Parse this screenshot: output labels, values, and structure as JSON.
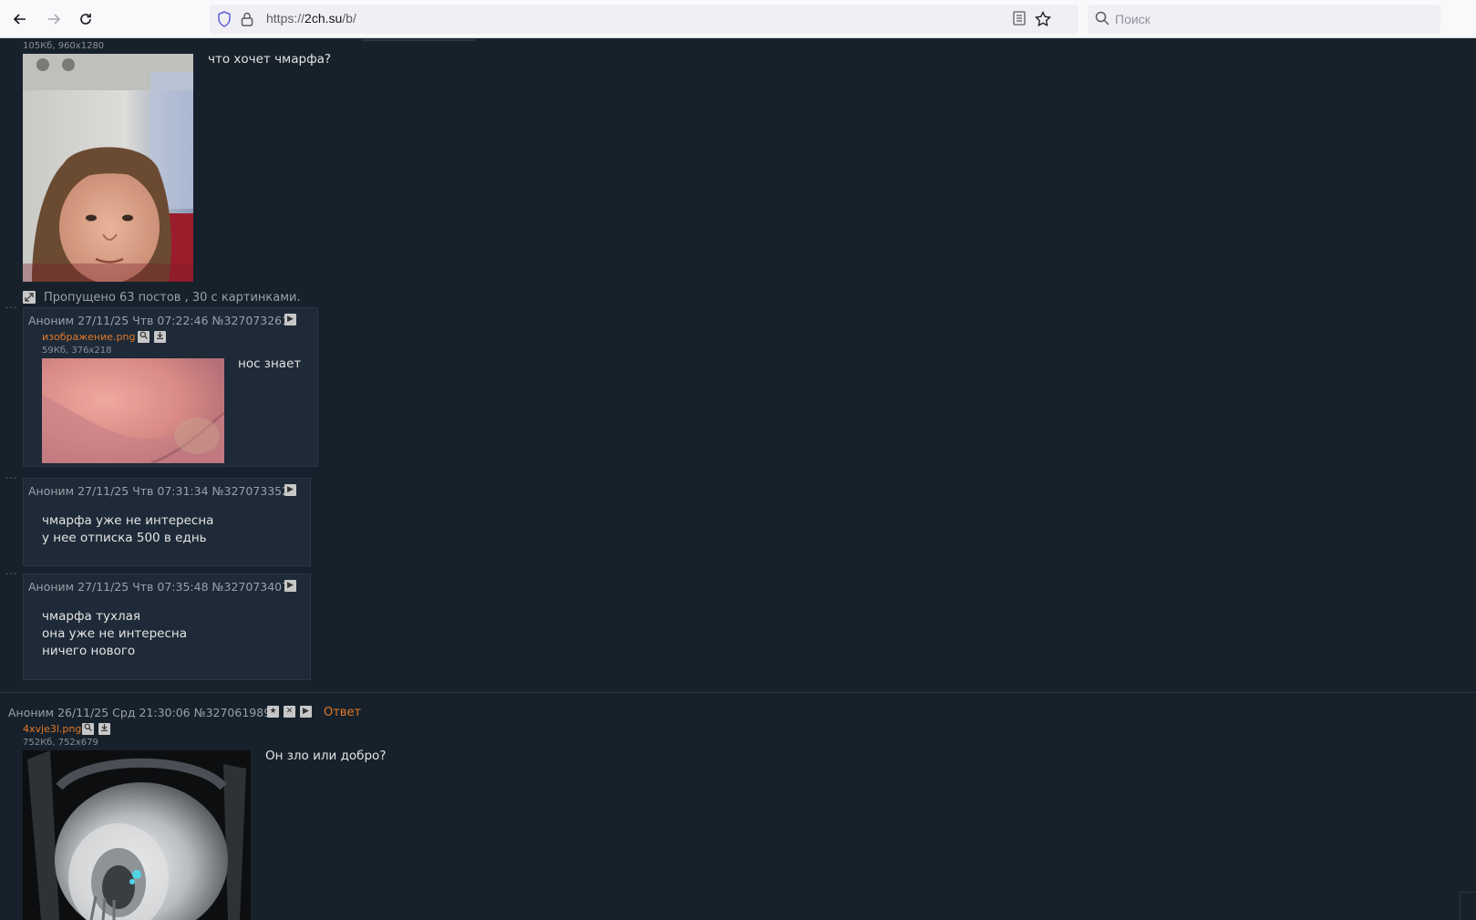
{
  "browser": {
    "url_prefix": "https://",
    "url_host": "2ch.su",
    "url_path": "/b/",
    "search_placeholder": "Поиск"
  },
  "op_thread1": {
    "file_info": "105Кб, 960x1280",
    "text": "что хочет чмарфа?",
    "omitted": "Пропущено 63 постов , 30 с картинками."
  },
  "replies": [
    {
      "meta": "Аноним 27/11/25 Чтв 07:22:46 №327073261",
      "file_name": "изображение.png",
      "file_info": "59Кб, 376x218",
      "text": "нос знает"
    },
    {
      "meta": "Аноним 27/11/25 Чтв 07:31:34 №327073352",
      "line1": "чмарфа уже не интересна",
      "line2": "у нее отписка 500 в еднь"
    },
    {
      "meta": "Аноним 27/11/25 Чтв 07:35:48 №327073407",
      "line1": "чмарфа тухлая",
      "line2": "она уже не интересна",
      "line3": "ничего нового"
    }
  ],
  "op_thread2": {
    "meta": "Аноним 26/11/25 Срд 21:30:06 №327061989",
    "reply_label": "Ответ",
    "file_name": "4xvje3l.png",
    "file_info": "752Кб, 752x679",
    "text": "Он зло или добро?"
  },
  "icons": {
    "back": "back-arrow-icon",
    "forward": "forward-arrow-icon",
    "reload": "reload-icon",
    "expand": "expand-icon",
    "search": "search-icon",
    "download": "download-icon",
    "play": "play-icon",
    "star": "star-icon",
    "close": "close-icon"
  }
}
